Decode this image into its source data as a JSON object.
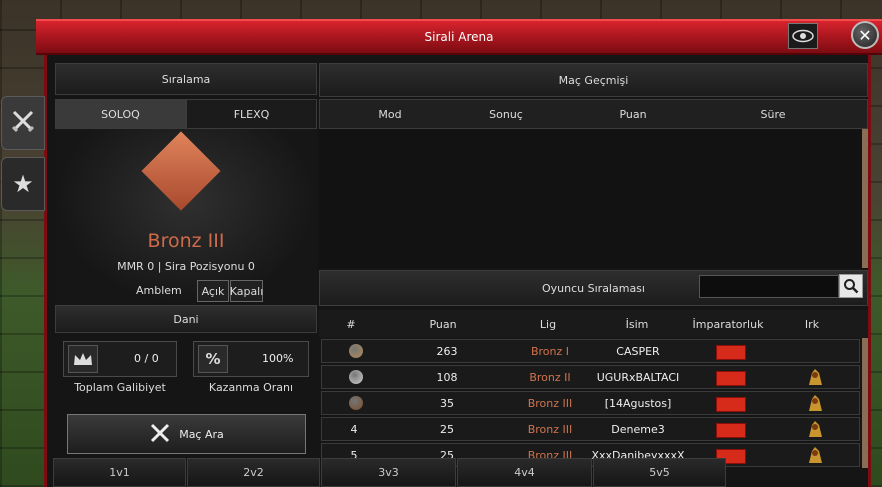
{
  "window": {
    "title": "Sirali Arena"
  },
  "left": {
    "header": "Sıralama",
    "queue_tabs": [
      "SOLOQ",
      "FLEXQ"
    ],
    "rank_name": "Bronz III",
    "mmr_text": "MMR 0 | Sira Pozisyonu 0",
    "emblem_label": "Amblem",
    "emblem_on": "Açık",
    "emblem_off": "Kapalı",
    "section": "Dani",
    "wins_value": "0 / 0",
    "wins_label": "Toplam Galibiyet",
    "winrate_value": "100%",
    "winrate_label": "Kazanma Oranı",
    "search_button": "Maç Ara"
  },
  "history": {
    "header": "Maç Geçmişi",
    "columns": [
      "Mod",
      "Sonuç",
      "Puan",
      "Süre"
    ]
  },
  "ranking": {
    "header": "Oyuncu Sıralaması",
    "search_placeholder": "",
    "columns": [
      "#",
      "Puan",
      "Lig",
      "İsim",
      "İmparatorluk",
      "Irk"
    ],
    "rows": [
      {
        "rank": "",
        "medal": "gold-medal-icon",
        "puan": "263",
        "lig": "Bronz I",
        "isim": "CASPER"
      },
      {
        "rank": "",
        "medal": "silver-medal-icon",
        "puan": "108",
        "lig": "Bronz II",
        "isim": "UGURxBALTACI"
      },
      {
        "rank": "",
        "medal": "bronze-medal-icon",
        "puan": "35",
        "lig": "Bronz III",
        "isim": "[14Agustos]"
      },
      {
        "rank": "4",
        "medal": "",
        "puan": "25",
        "lig": "Bronz III",
        "isim": "Deneme3"
      },
      {
        "rank": "5",
        "medal": "",
        "puan": "25",
        "lig": "Bronz III",
        "isim": "XxxDanibeyxxxX"
      }
    ]
  },
  "bottom_tabs": [
    "1v1",
    "2v2",
    "3v3",
    "4v4",
    "5v5"
  ],
  "colors": {
    "accent_red": "#b3131b",
    "lig_text": "#d1734f",
    "flag": "#d62a1b"
  },
  "icons": {
    "side_tab_1": "crossed-swords-icon",
    "side_tab_2": "star-icon",
    "eye": "eye-icon",
    "close": "close-icon",
    "search": "magnifier-icon",
    "wins": "crown-icon",
    "rate": "percent-icon"
  }
}
